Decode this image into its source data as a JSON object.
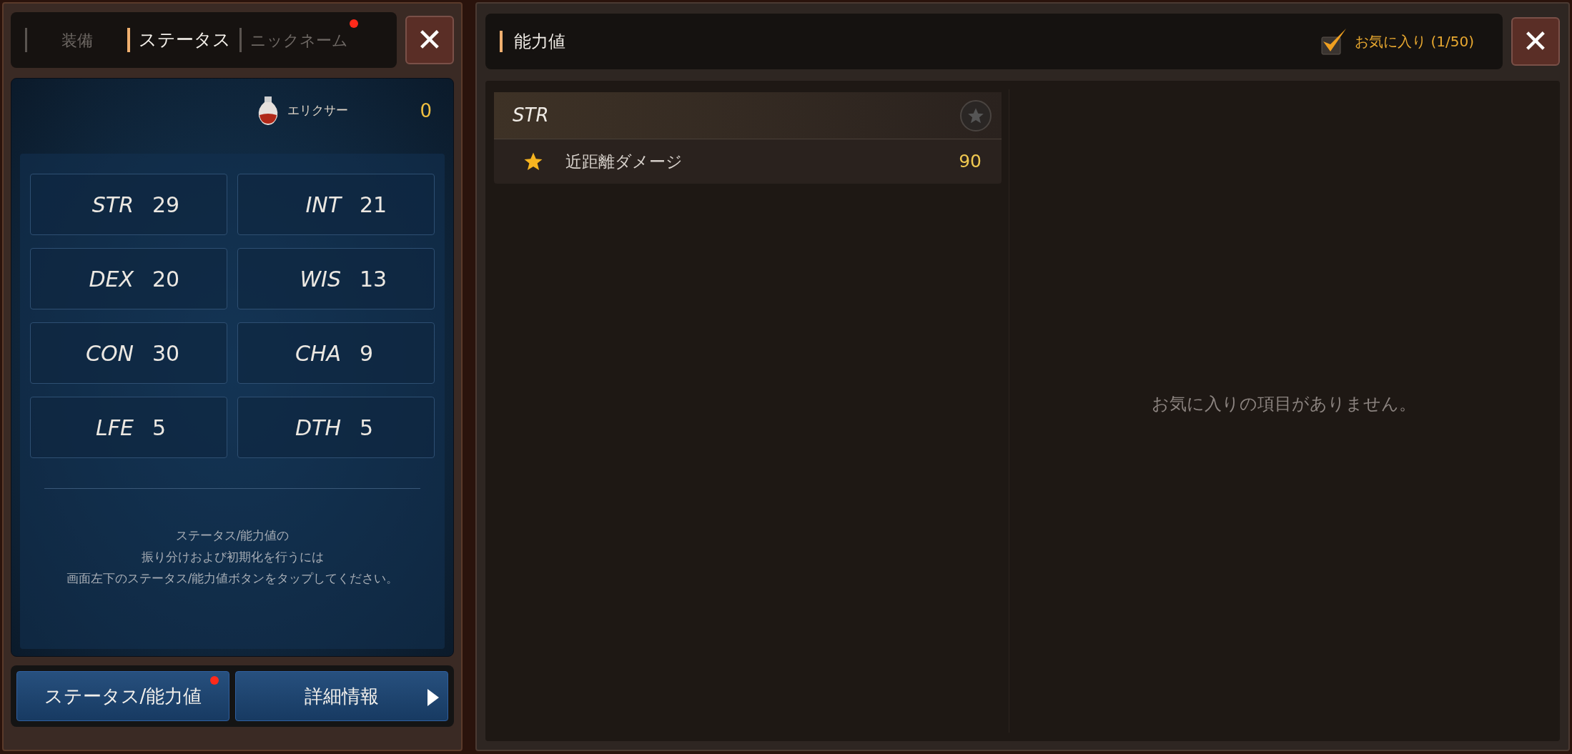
{
  "left_panel": {
    "tabs": [
      {
        "label": "装備",
        "selected": false,
        "badge": false
      },
      {
        "label": "ステータス",
        "selected": true,
        "badge": false
      },
      {
        "label": "ニックネーム",
        "selected": false,
        "badge": true
      }
    ],
    "close": "✕",
    "elixir": {
      "label": "エリクサー",
      "value": "0"
    },
    "stats": [
      {
        "name": "STR",
        "value": "29"
      },
      {
        "name": "INT",
        "value": "21"
      },
      {
        "name": "DEX",
        "value": "20"
      },
      {
        "name": "WIS",
        "value": "13"
      },
      {
        "name": "CON",
        "value": "30"
      },
      {
        "name": "CHA",
        "value": "9"
      },
      {
        "name": "LFE",
        "value": "5"
      },
      {
        "name": "DTH",
        "value": "5"
      }
    ],
    "hint_lines": [
      "ステータス/能力値の",
      "振り分けおよび初期化を行うには",
      "画面左下のステータス/能力値ボタンをタップしてください。"
    ],
    "buttons": [
      {
        "label": "ステータス/能力値",
        "badge": true,
        "arrow": false
      },
      {
        "label": "詳細情報",
        "badge": false,
        "arrow": true
      }
    ]
  },
  "right_panel": {
    "title": "能力値",
    "favorites_toggle": {
      "label": "お気に入り (1/50)",
      "checked": true
    },
    "close": "✕",
    "groups": [
      {
        "name": "STR",
        "favorite": false,
        "rows": [
          {
            "label": "近距離ダメージ",
            "value": "90",
            "favorite": true
          }
        ]
      }
    ],
    "empty_message": "お気に入りの項目がありません。"
  }
}
